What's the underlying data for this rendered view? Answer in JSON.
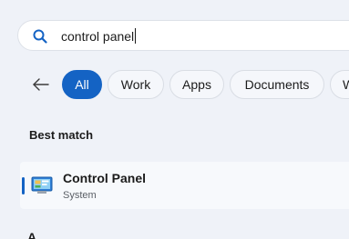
{
  "search": {
    "query": "control panel"
  },
  "filters": {
    "chips": [
      {
        "label": "All",
        "active": true
      },
      {
        "label": "Work",
        "active": false
      },
      {
        "label": "Apps",
        "active": false
      },
      {
        "label": "Documents",
        "active": false
      },
      {
        "label": "W",
        "active": false
      }
    ]
  },
  "results": {
    "section_heading": "Best match",
    "best_match": {
      "title": "Control Panel",
      "subtitle": "System",
      "icon": "control-panel-icon"
    },
    "next_section_partial": "A"
  },
  "colors": {
    "accent": "#1463c4",
    "background": "#eff2f8",
    "search_icon": "#1463c4"
  },
  "icons": {
    "search": "search-icon",
    "back": "back-arrow-icon"
  }
}
